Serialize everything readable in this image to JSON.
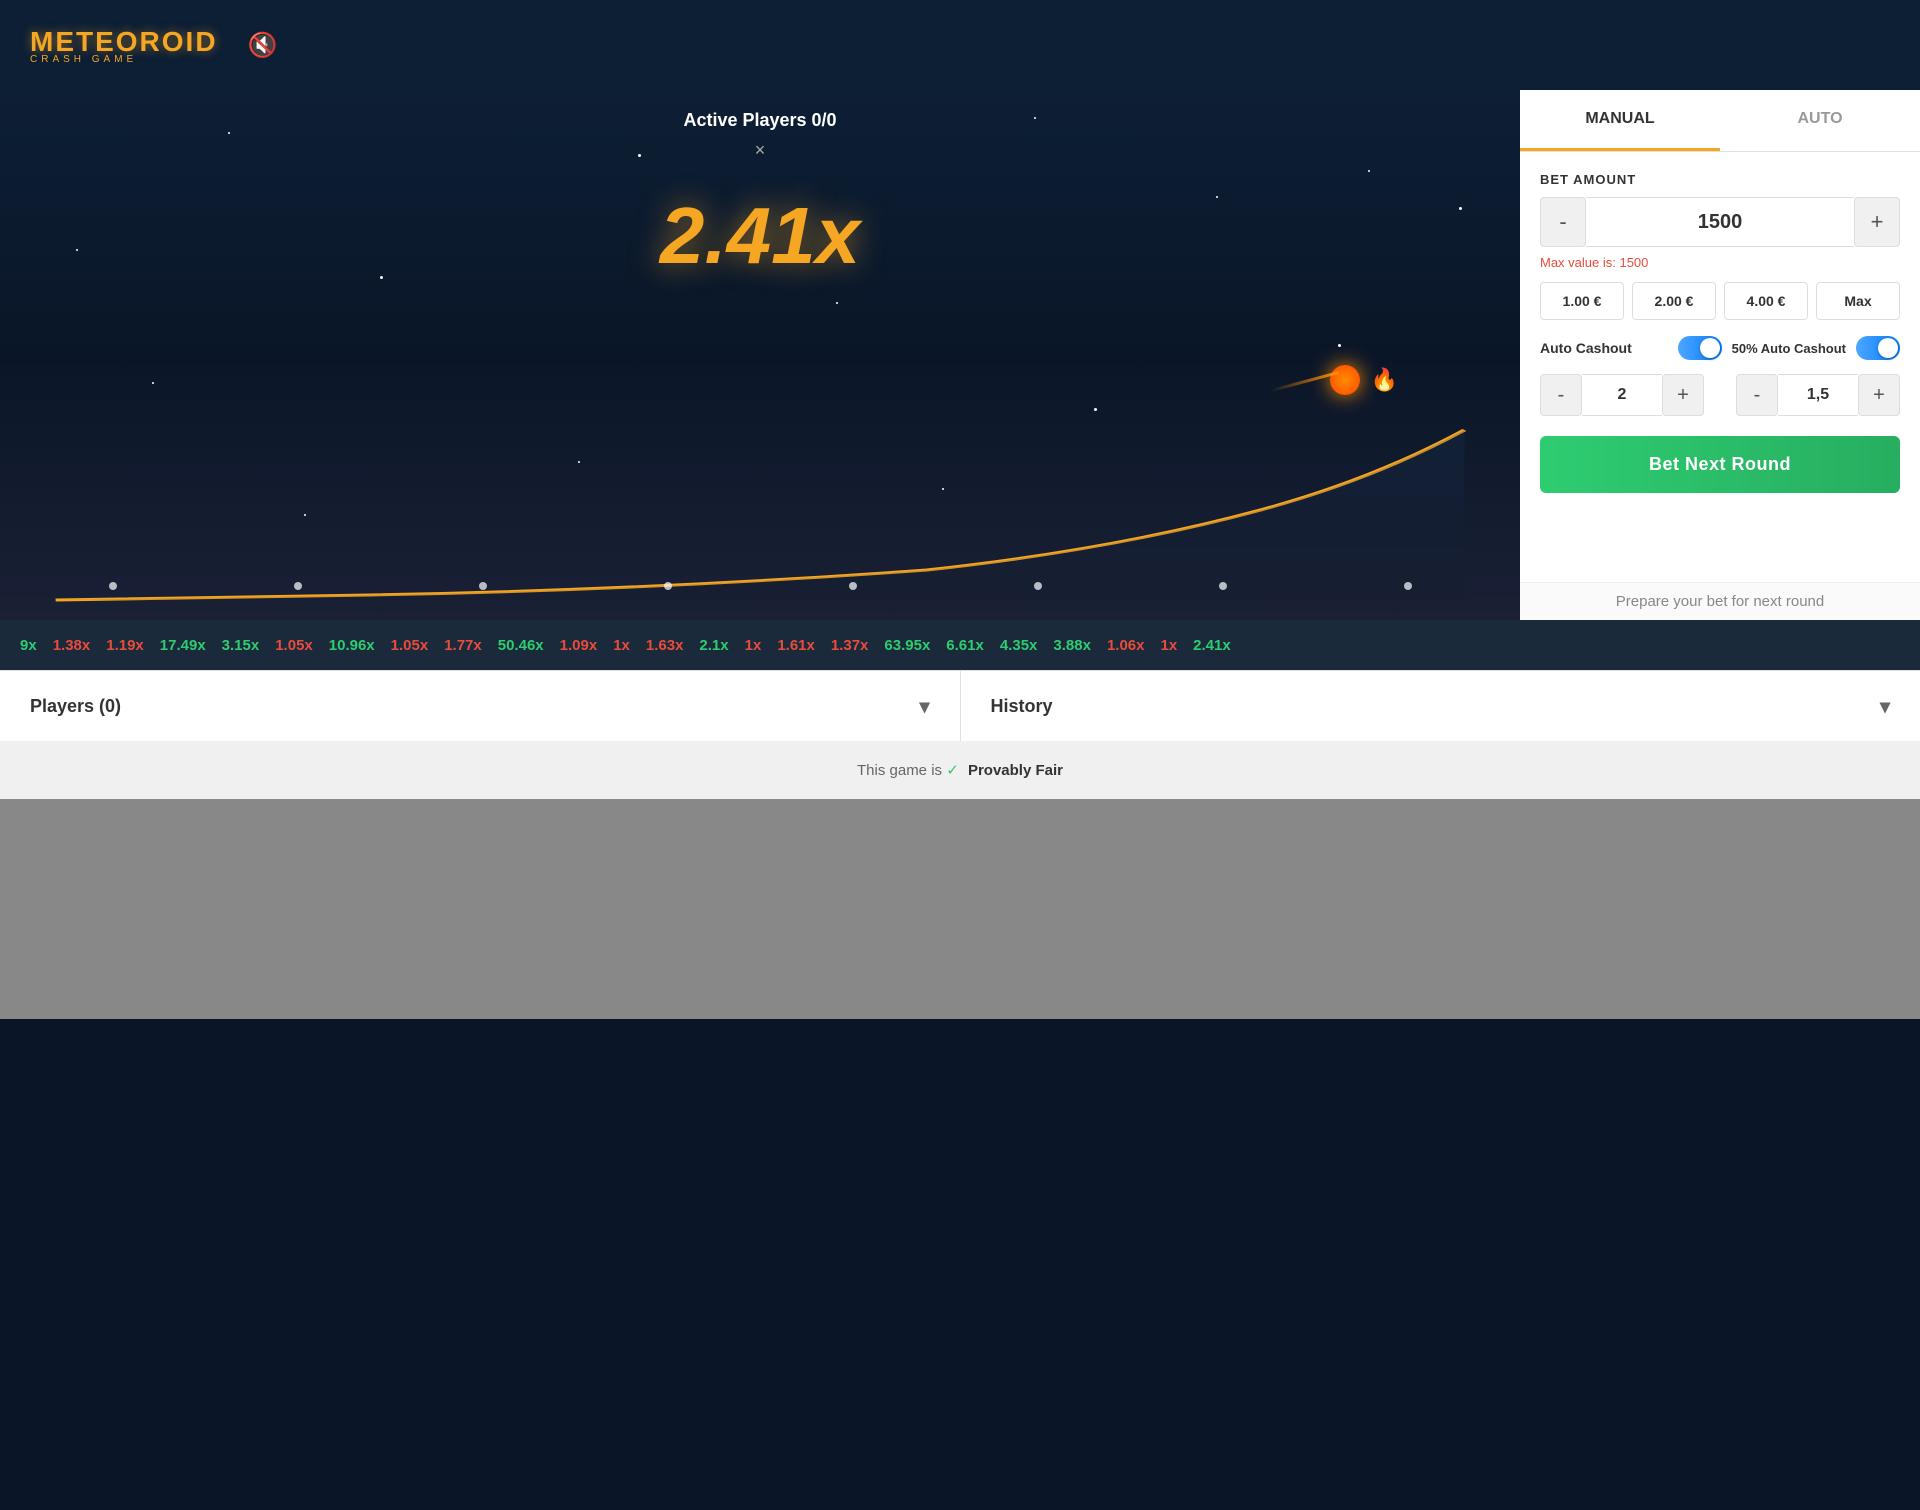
{
  "logo": {
    "name": "METEOROID",
    "sub": "CRASH GAME"
  },
  "game": {
    "active_players": "Active Players 0/0",
    "multiplier": "2.41x",
    "close_label": "×"
  },
  "panel": {
    "tab_manual": "MANUAL",
    "tab_auto": "AUTO",
    "bet_amount_label": "BET AMOUNT",
    "bet_value": "1500",
    "max_value_msg": "Max value is: 1500",
    "minus_label": "-",
    "plus_label": "+",
    "quick_bets": [
      {
        "label": "1.00 €"
      },
      {
        "label": "2.00 €"
      },
      {
        "label": "4.00 €"
      },
      {
        "label": "Max"
      }
    ],
    "auto_cashout_label": "Auto Cashout",
    "auto_cashout_50_label": "50% Auto Cashout",
    "auto_cashout_value": "2",
    "auto_cashout_50_value": "1,5",
    "bet_next_round_label": "Bet Next Round",
    "prepare_text": "Prepare your bet for next round"
  },
  "ticker": {
    "items": [
      {
        "value": "9x",
        "color": "green"
      },
      {
        "value": "1.38x",
        "color": "red"
      },
      {
        "value": "1.19x",
        "color": "red"
      },
      {
        "value": "17.49x",
        "color": "green"
      },
      {
        "value": "3.15x",
        "color": "green"
      },
      {
        "value": "1.05x",
        "color": "red"
      },
      {
        "value": "10.96x",
        "color": "green"
      },
      {
        "value": "1.05x",
        "color": "red"
      },
      {
        "value": "1.77x",
        "color": "red"
      },
      {
        "value": "50.46x",
        "color": "green"
      },
      {
        "value": "1.09x",
        "color": "red"
      },
      {
        "value": "1x",
        "color": "red"
      },
      {
        "value": "1.63x",
        "color": "red"
      },
      {
        "value": "2.1x",
        "color": "green"
      },
      {
        "value": "1x",
        "color": "red"
      },
      {
        "value": "1.61x",
        "color": "red"
      },
      {
        "value": "1.37x",
        "color": "red"
      },
      {
        "value": "63.95x",
        "color": "green"
      },
      {
        "value": "6.61x",
        "color": "green"
      },
      {
        "value": "4.35x",
        "color": "green"
      },
      {
        "value": "3.88x",
        "color": "green"
      },
      {
        "value": "1.06x",
        "color": "red"
      },
      {
        "value": "1x",
        "color": "red"
      },
      {
        "value": "2.41x",
        "color": "green"
      }
    ]
  },
  "bottom_panels": [
    {
      "label": "Players (0)"
    },
    {
      "label": "History"
    }
  ],
  "provably_fair": {
    "prefix": "This game is",
    "label": "Provably Fair"
  }
}
